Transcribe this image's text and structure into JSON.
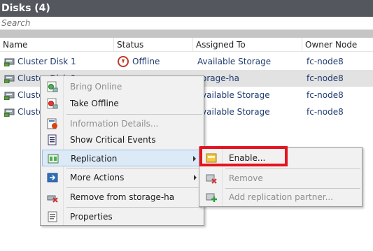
{
  "panel": {
    "title": "Disks (4)",
    "search_placeholder": "Search"
  },
  "columns": [
    "Name",
    "Status",
    "Assigned To",
    "Owner Node"
  ],
  "rows": [
    {
      "name": "Cluster Disk 1",
      "status": "Offline",
      "assigned": "Available Storage",
      "owner": "fc-node8"
    },
    {
      "name": "Cluster Disk 2",
      "status": "",
      "assigned": "orage-ha",
      "owner": "fc-node8"
    },
    {
      "name": "Cluste",
      "status": "",
      "assigned": "vailable Storage",
      "owner": "fc-node8"
    },
    {
      "name": "Cluste",
      "status": "",
      "assigned": "vailable Storage",
      "owner": "fc-node8"
    }
  ],
  "context_menu": {
    "items": [
      {
        "label": "Bring Online",
        "icon": "bring-online-icon",
        "disabled": true
      },
      {
        "label": "Take Offline",
        "icon": "take-offline-icon",
        "disabled": false
      },
      {
        "label": "Information Details...",
        "icon": "information-details-icon",
        "disabled": true
      },
      {
        "label": "Show Critical Events",
        "icon": "critical-events-icon",
        "disabled": false
      },
      {
        "label": "Replication",
        "icon": "replication-icon",
        "disabled": false,
        "submenu": true,
        "highlighted": true
      },
      {
        "label": "More Actions",
        "icon": "more-actions-icon",
        "disabled": false,
        "submenu": true
      },
      {
        "label": "Remove from storage-ha",
        "icon": "remove-from-role-icon",
        "disabled": false
      },
      {
        "label": "Properties",
        "icon": "properties-icon",
        "disabled": false
      }
    ]
  },
  "submenu": {
    "items": [
      {
        "label": "Enable...",
        "icon": "enable-replication-icon",
        "disabled": false
      },
      {
        "label": "Remove",
        "icon": "remove-replication-icon",
        "disabled": true
      },
      {
        "label": "Add replication partner...",
        "icon": "add-partner-icon",
        "disabled": true
      }
    ]
  },
  "colors": {
    "title_bar": "#54585e",
    "link_text": "#1f3b6f",
    "highlight_border": "#e3141f",
    "menu_highlight": "#dce9f7"
  }
}
